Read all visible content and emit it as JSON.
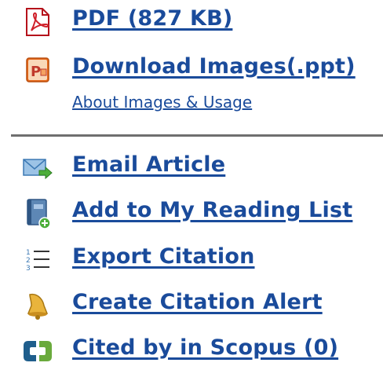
{
  "links": {
    "pdf": "PDF (827 KB)",
    "download_images": "Download Images(.ppt)",
    "about_images": "About Images & Usage",
    "email_article": "Email Article",
    "add_reading_list": "Add to My Reading List",
    "export_citation": "Export Citation",
    "create_alert": "Create Citation Alert",
    "cited_by_scopus": "Cited by in Scopus (0)"
  },
  "icons": {
    "pdf": "pdf-icon",
    "ppt": "powerpoint-icon",
    "email": "email-forward-icon",
    "reading_list": "book-add-icon",
    "export": "numbered-list-icon",
    "alert": "bell-icon",
    "scopus": "scopus-icon"
  },
  "colors": {
    "link": "#1a4b9b",
    "divider": "#6f6f6f"
  }
}
